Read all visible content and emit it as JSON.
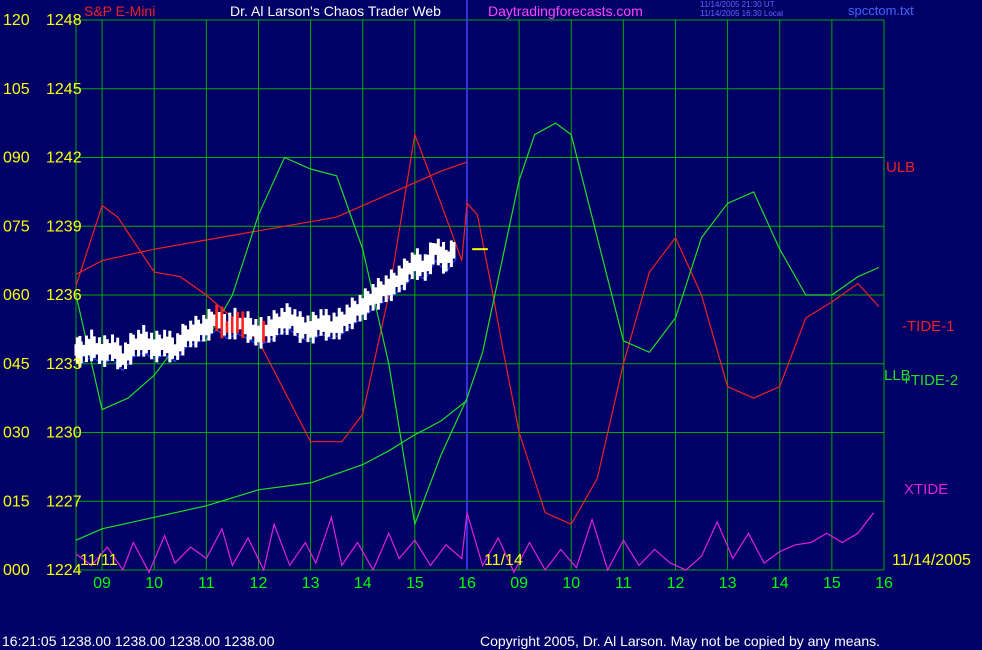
{
  "header": {
    "instrument": "S&P E-Mini",
    "author": "Dr. Al Larson's Chaos Trader Web",
    "site": "Daytradingforecasts.com",
    "file": "spcctom.txt",
    "time_lines": [
      "11/14/2005 21:30 UT",
      "11/14/2005 16:30 Local"
    ]
  },
  "footer": {
    "quote": "16:21:05  1238.00 1238.00 1238.00 1238.00",
    "copyright": "Copyright 2005, Dr. Al Larson. May not be copied by any means."
  },
  "colors": {
    "background": "#000066",
    "grid": "#00aa00",
    "price": "#ffffff",
    "ulb": "#ee2222",
    "tide1": "#ee2222",
    "tide2": "#22dd22",
    "llb": "#22dd22",
    "xtide": "#dd22dd",
    "axis_text": "#ffff00",
    "time_text": "#00ff00",
    "date_marker": "#4444ff"
  },
  "chart_data": {
    "type": "line",
    "y_labels": [
      {
        "left": "120",
        "right": "1248"
      },
      {
        "left": "105",
        "right": "1245"
      },
      {
        "left": "090",
        "right": "1242"
      },
      {
        "left": "075",
        "right": "1239"
      },
      {
        "left": "060",
        "right": "1236"
      },
      {
        "left": "045",
        "right": "1233"
      },
      {
        "left": "030",
        "right": "1230"
      },
      {
        "left": "015",
        "right": "1227"
      },
      {
        "left": "000",
        "right": "1224"
      }
    ],
    "ylim": [
      1224,
      1248
    ],
    "x_ticks": [
      "09",
      "10",
      "11",
      "12",
      "13",
      "14",
      "15",
      "16",
      "09",
      "10",
      "11",
      "12",
      "13",
      "14",
      "15",
      "16"
    ],
    "date_labels": [
      "11/11",
      "11/14",
      "11/14/2005"
    ],
    "series_labels": {
      "ulb": "ULB",
      "tide1": "-TIDE-1",
      "llb": "LLB",
      "tide2": "+TIDE-2",
      "xtide": "XTIDE"
    },
    "last_price": 1238.0,
    "price_series": [
      [
        8.5,
        1233.6
      ],
      [
        8.6,
        1233.5
      ],
      [
        8.8,
        1233.8
      ],
      [
        9.0,
        1233.5
      ],
      [
        9.2,
        1233.7
      ],
      [
        9.4,
        1233.2
      ],
      [
        9.6,
        1233.8
      ],
      [
        9.8,
        1234.0
      ],
      [
        10.0,
        1233.7
      ],
      [
        10.2,
        1233.9
      ],
      [
        10.4,
        1233.6
      ],
      [
        10.6,
        1234.2
      ],
      [
        10.8,
        1234.4
      ],
      [
        11.0,
        1234.6
      ],
      [
        11.2,
        1235.0
      ],
      [
        11.4,
        1234.6
      ],
      [
        11.6,
        1234.8
      ],
      [
        11.8,
        1234.6
      ],
      [
        12.0,
        1234.3
      ],
      [
        12.2,
        1234.5
      ],
      [
        12.4,
        1234.8
      ],
      [
        12.6,
        1235.0
      ],
      [
        12.8,
        1234.6
      ],
      [
        13.0,
        1234.5
      ],
      [
        13.2,
        1234.8
      ],
      [
        13.4,
        1234.6
      ],
      [
        13.6,
        1234.8
      ],
      [
        13.8,
        1235.2
      ],
      [
        14.0,
        1235.5
      ],
      [
        14.2,
        1235.9
      ],
      [
        14.4,
        1236.2
      ],
      [
        14.6,
        1236.5
      ],
      [
        14.8,
        1236.9
      ],
      [
        15.0,
        1237.4
      ],
      [
        15.2,
        1237.2
      ],
      [
        15.4,
        1238.0
      ],
      [
        15.6,
        1237.5
      ],
      [
        15.8,
        1238.1
      ]
    ],
    "ulb_series": [
      [
        8.5,
        1236.9
      ],
      [
        9.0,
        1237.5
      ],
      [
        10.0,
        1238.0
      ],
      [
        11.0,
        1238.4
      ],
      [
        12.0,
        1238.8
      ],
      [
        12.5,
        1239.0
      ],
      [
        13.0,
        1239.2
      ],
      [
        13.5,
        1239.4
      ],
      [
        14.0,
        1239.9
      ],
      [
        14.5,
        1240.4
      ],
      [
        15.0,
        1240.9
      ],
      [
        15.5,
        1241.4
      ],
      [
        16.0,
        1241.8
      ]
    ],
    "llb_series": [
      [
        8.5,
        1225.3
      ],
      [
        9.0,
        1225.8
      ],
      [
        10.0,
        1226.3
      ],
      [
        11.0,
        1226.8
      ],
      [
        12.0,
        1227.5
      ],
      [
        13.0,
        1227.8
      ],
      [
        14.0,
        1228.6
      ],
      [
        14.5,
        1229.2
      ],
      [
        15.0,
        1229.9
      ],
      [
        15.5,
        1230.5
      ],
      [
        16.0,
        1231.4
      ]
    ],
    "tide1_series": [
      [
        8.5,
        1236.4
      ],
      [
        9.0,
        1239.9
      ],
      [
        9.3,
        1239.4
      ],
      [
        10.0,
        1237.0
      ],
      [
        10.5,
        1236.8
      ],
      [
        11.0,
        1236.0
      ],
      [
        12.0,
        1234.0
      ],
      [
        13.0,
        1229.6
      ],
      [
        13.6,
        1229.6
      ],
      [
        14.0,
        1230.8
      ],
      [
        14.5,
        1236.0
      ],
      [
        15.0,
        1243.0
      ],
      [
        15.5,
        1240.0
      ],
      [
        15.9,
        1237.5
      ],
      [
        16.0,
        1240.0
      ],
      [
        16.2,
        1239.5
      ],
      [
        16.5,
        1236.0
      ],
      [
        16.7,
        1233.5
      ],
      [
        17.0,
        1230.0
      ],
      [
        17.5,
        1226.5
      ],
      [
        18.0,
        1226.0
      ],
      [
        18.5,
        1228.0
      ],
      [
        19.0,
        1233.0
      ],
      [
        19.5,
        1237.0
      ],
      [
        20.0,
        1238.5
      ],
      [
        20.5,
        1236.0
      ],
      [
        21.0,
        1232.0
      ],
      [
        21.5,
        1231.5
      ],
      [
        22.0,
        1232.0
      ],
      [
        22.5,
        1235.0
      ],
      [
        23.0,
        1235.7
      ],
      [
        23.5,
        1236.5
      ],
      [
        23.9,
        1235.5
      ]
    ],
    "tide2_series": [
      [
        8.5,
        1236.0
      ],
      [
        9.0,
        1231.0
      ],
      [
        9.5,
        1231.5
      ],
      [
        10.0,
        1232.5
      ],
      [
        10.5,
        1234.0
      ],
      [
        11.0,
        1234.0
      ],
      [
        11.5,
        1236.0
      ],
      [
        12.0,
        1239.5
      ],
      [
        12.5,
        1242.0
      ],
      [
        13.0,
        1241.5
      ],
      [
        13.5,
        1241.2
      ],
      [
        14.0,
        1238.0
      ],
      [
        14.5,
        1233.0
      ],
      [
        15.0,
        1226.0
      ],
      [
        15.5,
        1229.0
      ],
      [
        16.0,
        1231.5
      ],
      [
        16.3,
        1233.5
      ],
      [
        17.0,
        1241.0
      ],
      [
        17.3,
        1243.0
      ],
      [
        17.7,
        1243.5
      ],
      [
        18.0,
        1243.0
      ],
      [
        18.5,
        1238.5
      ],
      [
        19.0,
        1234.0
      ],
      [
        19.5,
        1233.5
      ],
      [
        20.0,
        1235.0
      ],
      [
        20.5,
        1238.5
      ],
      [
        21.0,
        1240.0
      ],
      [
        21.5,
        1240.5
      ],
      [
        22.0,
        1238.0
      ],
      [
        22.5,
        1236.0
      ],
      [
        23.0,
        1236.0
      ],
      [
        23.5,
        1236.8
      ],
      [
        23.9,
        1237.2
      ]
    ],
    "xtide_series": [
      [
        8.5,
        1224.7
      ],
      [
        8.8,
        1224.2
      ],
      [
        9.1,
        1225.0
      ],
      [
        9.4,
        1224.0
      ],
      [
        9.6,
        1225.2
      ],
      [
        9.9,
        1223.9
      ],
      [
        10.2,
        1225.5
      ],
      [
        10.4,
        1224.3
      ],
      [
        10.7,
        1225.0
      ],
      [
        11.0,
        1224.5
      ],
      [
        11.3,
        1225.8
      ],
      [
        11.5,
        1224.2
      ],
      [
        11.8,
        1225.4
      ],
      [
        12.1,
        1224.0
      ],
      [
        12.3,
        1226.0
      ],
      [
        12.6,
        1224.2
      ],
      [
        12.9,
        1225.2
      ],
      [
        13.1,
        1224.3
      ],
      [
        13.4,
        1226.3
      ],
      [
        13.6,
        1224.2
      ],
      [
        13.9,
        1225.2
      ],
      [
        14.2,
        1224.0
      ],
      [
        14.5,
        1225.6
      ],
      [
        14.7,
        1224.5
      ],
      [
        15.0,
        1225.3
      ],
      [
        15.3,
        1224.2
      ],
      [
        15.6,
        1225.1
      ],
      [
        15.9,
        1224.5
      ],
      [
        16.0,
        1226.5
      ],
      [
        16.3,
        1224.2
      ],
      [
        16.6,
        1225.4
      ],
      [
        16.9,
        1223.9
      ],
      [
        17.2,
        1225.2
      ],
      [
        17.5,
        1224.0
      ],
      [
        17.8,
        1224.9
      ],
      [
        18.1,
        1224.1
      ],
      [
        18.4,
        1226.2
      ],
      [
        18.7,
        1224.0
      ],
      [
        19.0,
        1225.3
      ],
      [
        19.3,
        1224.2
      ],
      [
        19.6,
        1224.9
      ],
      [
        19.9,
        1224.3
      ],
      [
        20.2,
        1224.0
      ],
      [
        20.5,
        1224.6
      ],
      [
        20.8,
        1226.1
      ],
      [
        21.1,
        1224.5
      ],
      [
        21.4,
        1225.6
      ],
      [
        21.7,
        1224.3
      ],
      [
        22.0,
        1224.8
      ],
      [
        22.3,
        1225.1
      ],
      [
        22.6,
        1225.2
      ],
      [
        22.9,
        1225.6
      ],
      [
        23.2,
        1225.2
      ],
      [
        23.5,
        1225.6
      ],
      [
        23.8,
        1226.5
      ]
    ]
  }
}
